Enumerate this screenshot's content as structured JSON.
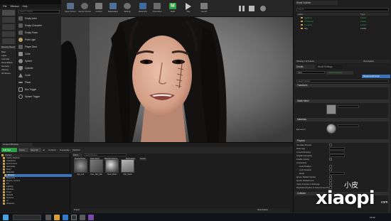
{
  "window": {
    "menu": [
      "File",
      "Window",
      "Help"
    ],
    "top_right_label": "Unreal Editor"
  },
  "modes": {
    "title": "Modes"
  },
  "place": {
    "search_placeholder": "Search Classes",
    "categories": [
      "Recently Placed",
      "Basic",
      "Lights",
      "Cinematic",
      "Visual Effects",
      "Geometry",
      "Volumes",
      "All Classes"
    ],
    "items": [
      "Empty Actor",
      "Empty Character",
      "Empty Pawn",
      "Point Light",
      "Player Start",
      "Cube",
      "Sphere",
      "Cylinder",
      "Cone",
      "Plane",
      "Box Trigger",
      "Sphere Trigger"
    ]
  },
  "toolbar": {
    "buttons": [
      "Save Current",
      "Source Control",
      "Content",
      "Marketplace",
      "Settings",
      "Blueprints",
      "Cinematics",
      "Build",
      "Play",
      "Launch"
    ]
  },
  "outliner": {
    "title": "World Outliner",
    "search_placeholder": "Search...",
    "columns": [
      "Label",
      "Type"
    ],
    "rows": [
      {
        "label": "Lighting",
        "type": "Folder"
      },
      {
        "label": "Character",
        "type": "Folder"
      },
      {
        "label": "Camera",
        "type": "Folder"
      },
      {
        "label": "Sky",
        "type": "Folder"
      }
    ],
    "status": "Showing 1 of 5 actors",
    "view_options": "View Options"
  },
  "details": {
    "tab": "Details",
    "world_settings": "World Settings",
    "selected": "Face",
    "add_component": "+ Add Component",
    "blueprint_button": "Blueprint/Add Script",
    "search_placeholder": "Search Details",
    "sections": [
      "Transform",
      "Static Mesh",
      "Materials",
      "Physics",
      "Collision",
      "Lighting"
    ],
    "transform_label": "Transform",
    "static_mesh_label": "Static Mesh",
    "materials_label": "Materials",
    "element_label": "Element 0",
    "physics_label": "Physics",
    "collision_label": "Collision",
    "physics_props": [
      "Simulate Physics",
      "Mass (kg)",
      "Linear Damping",
      "Angular Damping",
      "Enable Gravity",
      "Constraints",
      "Lock Position",
      "Lock Rotation",
      "Mode",
      "Ignore Radial Impulse",
      "Ignore Radial Force",
      "Apply Impulse on Damage",
      "Replicate Physics to Autonomous Proxy"
    ]
  },
  "content_browser": {
    "title": "Content Browser",
    "add_new": "Add New",
    "import": "Import",
    "save_all": "Save All",
    "path": [
      "Content",
      "Gameplay",
      "Meshes"
    ],
    "filters": "Filters",
    "search_placeholder": "Search Meshes",
    "filter_tabs": [
      "Skeletal Mesh",
      "Static Mesh",
      "Material Instance",
      "Static Mesh",
      "Texture"
    ],
    "folders": [
      "Content",
      "Cache_Meshes",
      "Characters",
      "Environment",
      "Gameplay",
      "Maps",
      "Materials",
      "Meshes",
      "Blueprints",
      "Engine_Content",
      "FX",
      "Lighting",
      "Particles",
      "Props",
      "Sounds",
      "Textures",
      "UI",
      "Weapons"
    ],
    "assets": [
      {
        "name": "Eye_Left"
      },
      {
        "name": "Face_Skin_Mat"
      },
      {
        "name": "Head_Model"
      },
      {
        "name": "Hair_Cards"
      }
    ],
    "item_count": "8 items",
    "view_options": "View Options"
  },
  "taskbar": {
    "time": "14:32"
  },
  "watermark": {
    "cn": "小皮",
    "latin": "xiaopi",
    "suffix": "com"
  },
  "colors": {
    "accent_green": "#2ea043",
    "selection_blue": "#3a74b8",
    "folder_yellow": "#c9a24a"
  }
}
